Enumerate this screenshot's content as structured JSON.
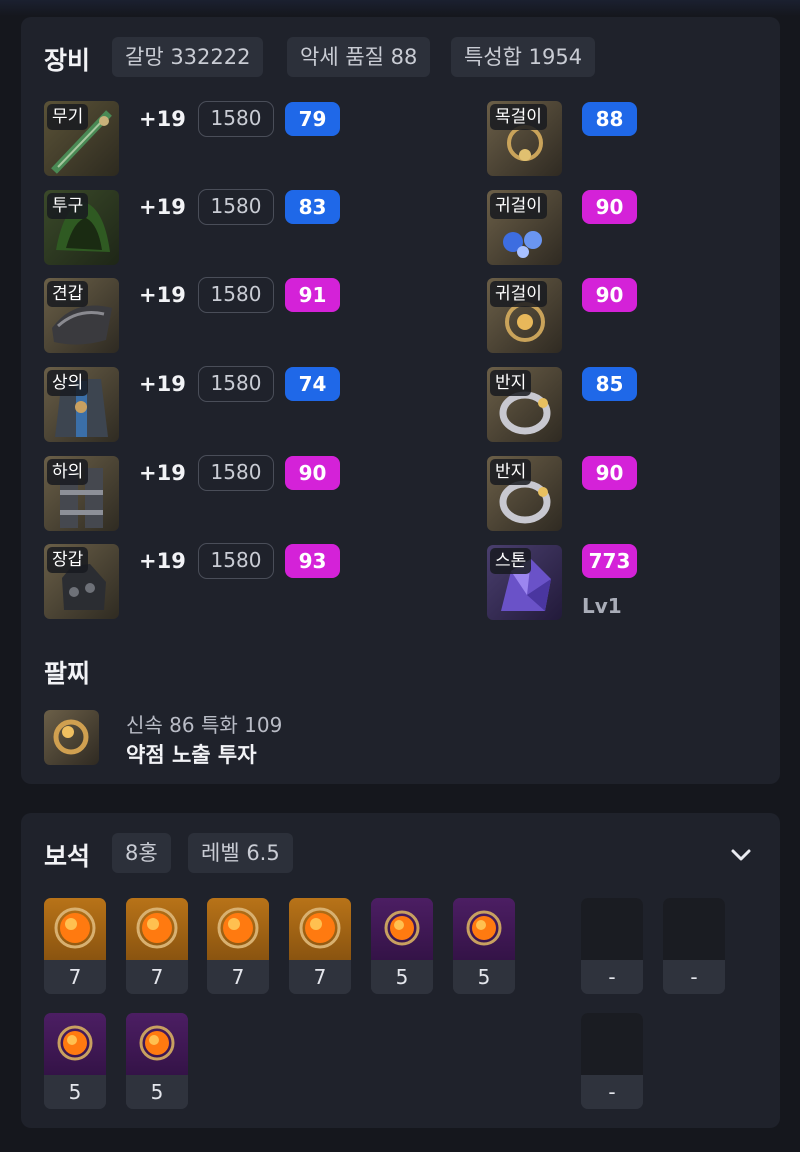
{
  "equipment": {
    "title": "장비",
    "chips": [
      "갈망 332222",
      "악세 품질 88",
      "특성합 1954"
    ],
    "armor": [
      {
        "tag": "무기",
        "plus": "+19",
        "ilvl": "1580",
        "quality": "79",
        "qcolor": "blue",
        "icon": "sword-icon"
      },
      {
        "tag": "투구",
        "plus": "+19",
        "ilvl": "1580",
        "quality": "83",
        "qcolor": "blue",
        "icon": "helmet-icon"
      },
      {
        "tag": "견갑",
        "plus": "+19",
        "ilvl": "1580",
        "quality": "91",
        "qcolor": "pink",
        "icon": "shoulder-icon"
      },
      {
        "tag": "상의",
        "plus": "+19",
        "ilvl": "1580",
        "quality": "74",
        "qcolor": "blue",
        "icon": "chest-armor-icon"
      },
      {
        "tag": "하의",
        "plus": "+19",
        "ilvl": "1580",
        "quality": "90",
        "qcolor": "pink",
        "icon": "pants-icon"
      },
      {
        "tag": "장갑",
        "plus": "+19",
        "ilvl": "1580",
        "quality": "93",
        "qcolor": "pink",
        "icon": "gloves-icon"
      }
    ],
    "accessories": [
      {
        "tag": "목걸이",
        "quality": "88",
        "qcolor": "blue",
        "icon": "necklace-icon"
      },
      {
        "tag": "귀걸이",
        "quality": "90",
        "qcolor": "pink",
        "icon": "earring-icon"
      },
      {
        "tag": "귀걸이",
        "quality": "90",
        "qcolor": "pink",
        "icon": "earring-icon"
      },
      {
        "tag": "반지",
        "quality": "85",
        "qcolor": "blue",
        "icon": "ring-icon"
      },
      {
        "tag": "반지",
        "quality": "90",
        "qcolor": "pink",
        "icon": "ring-icon"
      }
    ],
    "stone": {
      "tag": "스톤",
      "value": "773",
      "level": "Lv1",
      "icon": "stone-icon"
    },
    "bracelet": {
      "title": "팔찌",
      "stats": "신속 86  특화 109",
      "effects": "약점 노출  투자",
      "icon": "bracelet-icon"
    }
  },
  "gems": {
    "title": "보석",
    "chips": [
      "8홍",
      "레벨 6.5"
    ],
    "row1": [
      {
        "level": "7",
        "color": "orange"
      },
      {
        "level": "7",
        "color": "orange"
      },
      {
        "level": "7",
        "color": "orange"
      },
      {
        "level": "7",
        "color": "orange"
      },
      {
        "level": "5",
        "color": "purple"
      },
      {
        "level": "5",
        "color": "purple"
      }
    ],
    "row1_empty": [
      "-",
      "-"
    ],
    "row2": [
      {
        "level": "5",
        "color": "purple"
      },
      {
        "level": "5",
        "color": "purple"
      }
    ],
    "row2_empty": [
      "-"
    ],
    "expand_icon": "chevron-down-icon"
  },
  "colors": {
    "blue": "#1f68e8",
    "pink": "#d422d8",
    "card": "#1f222b",
    "background": "#15171d"
  }
}
